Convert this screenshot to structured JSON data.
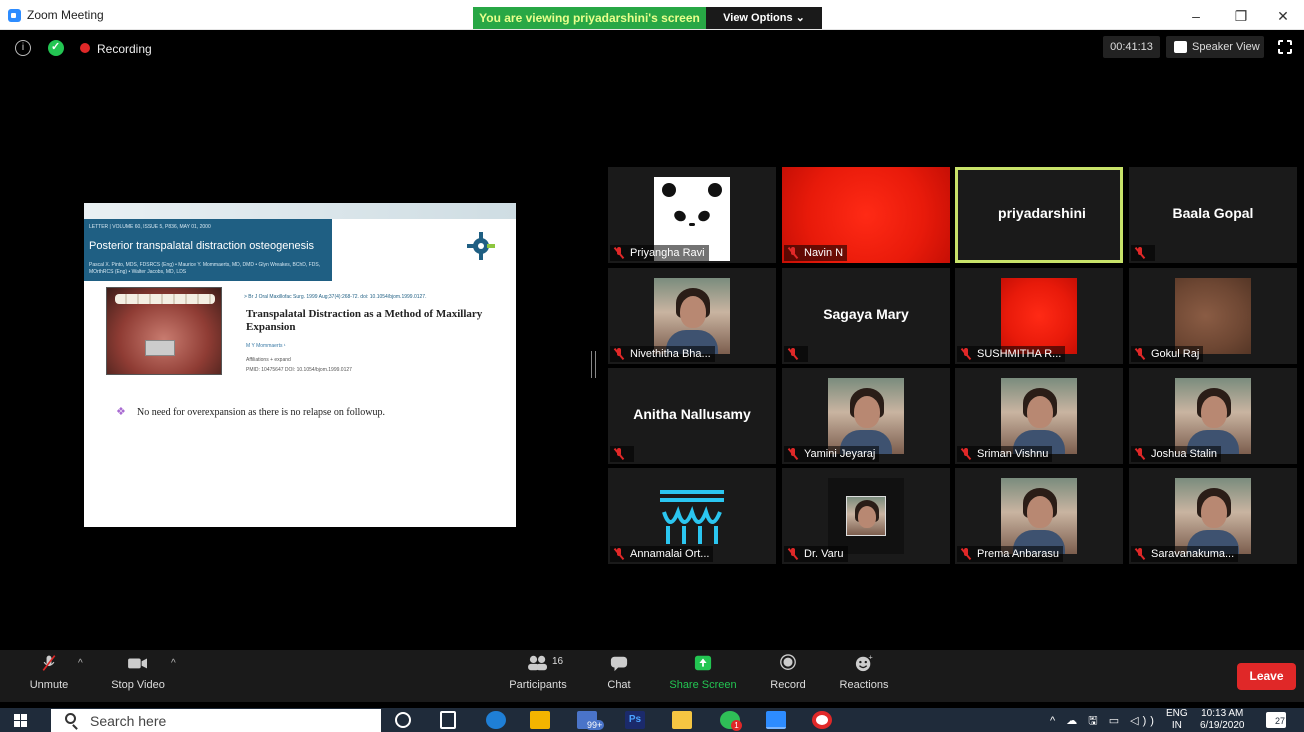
{
  "window": {
    "title": "Zoom Meeting",
    "banner": "You are viewing priyadarshini's screen",
    "view_options": "View Options ⌄",
    "controls": [
      "–",
      "❐",
      "✕"
    ]
  },
  "status": {
    "recording_label": "Recording",
    "timer": "00:41:13",
    "speaker_view": "Speaker View",
    "info_symbol": "i"
  },
  "shared_slide": {
    "header_small": "LETTER | VOLUME 60, ISSUE 5, P836, MAY 01, 2000",
    "header_title": "Posterior transpalatal distraction osteogenesis",
    "header_authors": "Pascal X. Pinto, MDS, FDSRCS (Eng) • Maurice Y. Mommaerts, MD, DMD • Glyn Wreakes, BChD, FDS, MOrthRCS (Eng) • Walter Jacobs, MD, LDS",
    "citation": "> Br J Oral Maxillofac Surg. 1999 Aug;37(4):268-72. doi: 10.1054/bjom.1999.0127.",
    "article_title": "Transpalatal Distraction as a Method of Maxillary Expansion",
    "article_author": "M Y Mommaerts ¹",
    "affiliations": "Affiliations  + expand",
    "pmid": "PMID: 10475647   DOI: 10.1054/bjom.1999.0127",
    "bullet_symbol": "❖",
    "bullet": "No need for overexpansion as there is no relapse on followup."
  },
  "participants": [
    {
      "name": "Priyangha Ravi",
      "type": "panda",
      "muted": true
    },
    {
      "name": "Navin N",
      "type": "red",
      "muted": true
    },
    {
      "name": "priyadarshini",
      "type": "text",
      "muted": false,
      "active": true
    },
    {
      "name": "Baala Gopal",
      "type": "text",
      "muted": true,
      "plate": ""
    },
    {
      "name": "Nivethitha Bha...",
      "type": "face",
      "muted": true
    },
    {
      "name": "Sagaya Mary",
      "type": "text",
      "muted": true,
      "plate": ""
    },
    {
      "name": "SUSHMITHA R...",
      "type": "red-small",
      "muted": true
    },
    {
      "name": "Gokul Raj",
      "type": "brown",
      "muted": true
    },
    {
      "name": "Anitha Nallusamy",
      "type": "text",
      "muted": true,
      "plate": ""
    },
    {
      "name": "Yamini Jeyaraj",
      "type": "face",
      "muted": true
    },
    {
      "name": "Sriman Vishnu",
      "type": "face",
      "muted": true
    },
    {
      "name": "Joshua Stalin",
      "type": "face",
      "muted": true
    },
    {
      "name": "Annamalai Ort...",
      "type": "tooth",
      "muted": true
    },
    {
      "name": "Dr. Varu",
      "type": "face-small",
      "muted": true
    },
    {
      "name": "Prema Anbarasu",
      "type": "face",
      "muted": true
    },
    {
      "name": "Saravanakuma...",
      "type": "face",
      "muted": true
    }
  ],
  "toolbar": {
    "unmute": "Unmute",
    "stop_video": "Stop Video",
    "participants": "Participants",
    "participants_count": "16",
    "chat": "Chat",
    "share_screen": "Share Screen",
    "record": "Record",
    "reactions": "Reactions",
    "leave": "Leave",
    "caret": "^"
  },
  "taskbar": {
    "search_placeholder": "Search here",
    "language": "ENG",
    "region": "IN",
    "time": "10:13 AM",
    "date": "6/19/2020",
    "badge_mail": "99+",
    "badge_whatsapp": "1",
    "ps_label": "Ps",
    "notifications": "27",
    "tray_icons": "^ ☁ 🖫 ▭ ◁))"
  },
  "colors": {
    "banner_bg": "#28a745",
    "leave_bg": "#e02828",
    "active_border": "#c8e36a",
    "share_screen_icon": "#23c552"
  }
}
